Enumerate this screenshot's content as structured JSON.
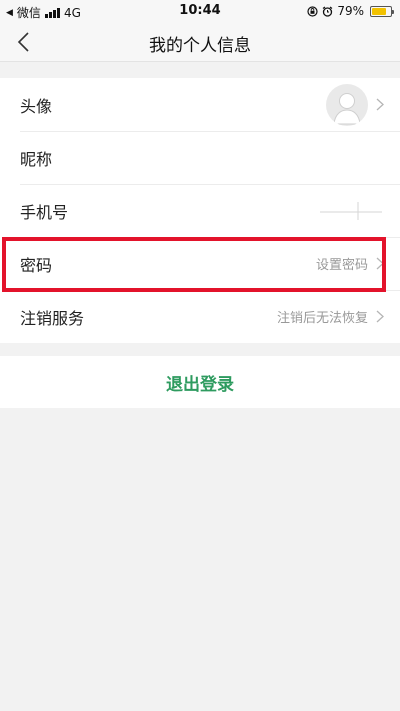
{
  "status_bar": {
    "carrier": "微信",
    "network": "4G",
    "time": "10:44",
    "battery_percent": "79%",
    "battery_level": 0.79
  },
  "nav": {
    "title": "我的个人信息"
  },
  "profile": {
    "rows": [
      {
        "label": "头像",
        "value": ""
      },
      {
        "label": "昵称",
        "value": ""
      },
      {
        "label": "手机号",
        "value": ""
      },
      {
        "label": "密码",
        "value": "设置密码"
      },
      {
        "label": "注销服务",
        "value": "注销后无法恢复"
      }
    ]
  },
  "logout_label": "退出登录",
  "colors": {
    "accent_green": "#2e9b5f",
    "highlight_red": "#e3132b",
    "battery_yellow": "#f2c200"
  }
}
